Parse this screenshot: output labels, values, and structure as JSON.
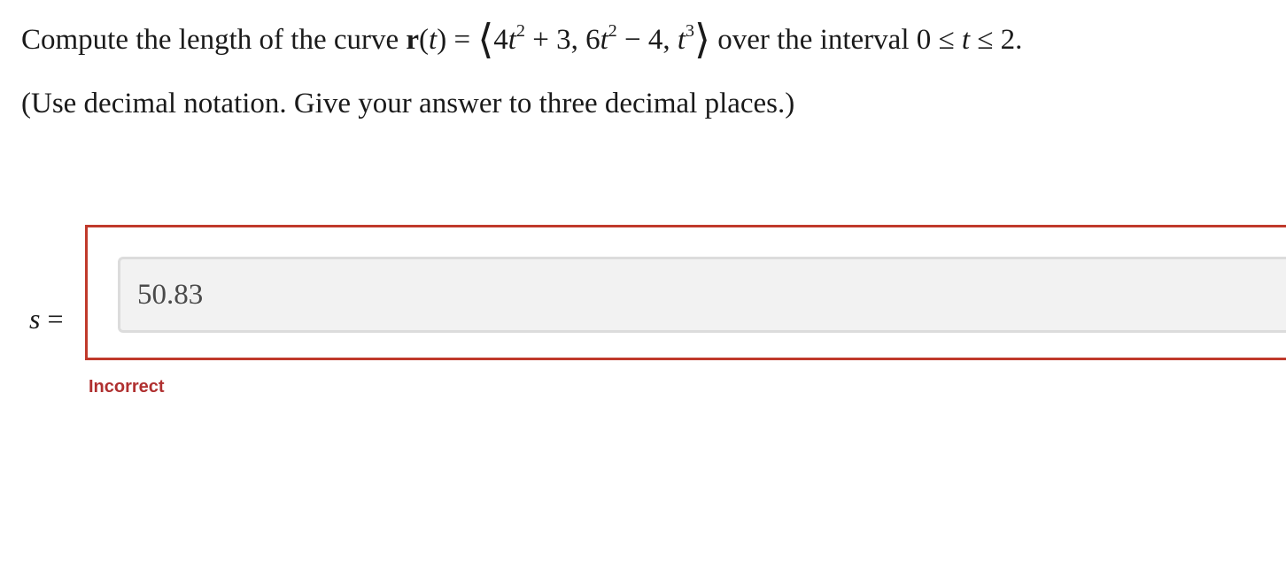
{
  "question": {
    "text_before": "Compute the length of the curve ",
    "func_name": "r",
    "func_arg_open": "(",
    "func_var": "t",
    "func_arg_close": ") = ",
    "lang": "⟨",
    "c1": "4",
    "v1": "t",
    "e1": "2",
    "c1b": " + 3, 6",
    "v2": "t",
    "e2": "2",
    "c2b": " − 4, ",
    "v3": "t",
    "e3": "3",
    "rang": "⟩",
    "text_mid": " over the interval 0 ≤ ",
    "v4": "t",
    "text_end": " ≤ 2."
  },
  "instruction": "(Use decimal notation. Give your answer to three decimal places.)",
  "answer": {
    "variable": "s",
    "equals": " =",
    "value": "50.83",
    "status": "Incorrect"
  },
  "colors": {
    "error": "#c0392b",
    "input_bg": "#f2f2f2"
  }
}
